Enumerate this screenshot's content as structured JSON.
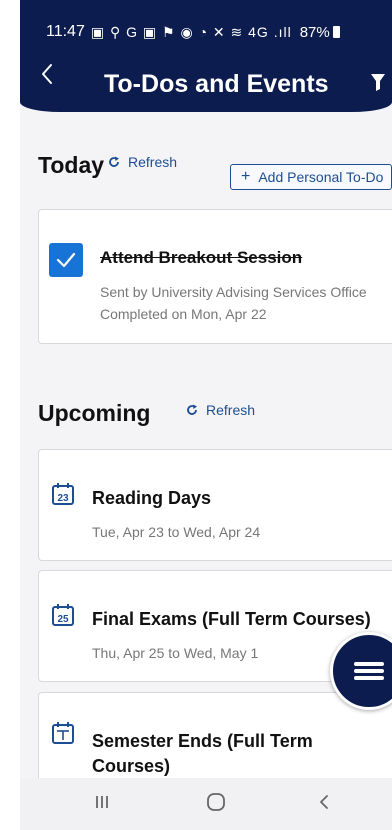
{
  "status_bar": {
    "time": "11:47",
    "icons_text": "▣ ⚲ G ▣ ⚑  ◉ ◔ ✕ ≋ 4G .ıll",
    "battery": "87%"
  },
  "header": {
    "title": "To-Dos and Events",
    "back_icon": "back-arrow-icon",
    "filter_icon": "filter-icon"
  },
  "today": {
    "title": "Today",
    "refresh_label": "Refresh",
    "add_button_label": "Add Personal To-Do",
    "items": [
      {
        "title": "Attend Breakout Session",
        "sender": "Sent by University Advising Services Office",
        "completed": "Completed on Mon, Apr 22",
        "checked": true
      }
    ]
  },
  "upcoming": {
    "title": "Upcoming",
    "refresh_label": "Refresh",
    "events": [
      {
        "title": "Reading Days",
        "dates": "Tue, Apr 23 to Wed, Apr 24",
        "icon_day": "23"
      },
      {
        "title": "Final Exams (Full Term Courses)",
        "dates": "Thu, Apr 25 to Wed, May 1",
        "icon_day": "25"
      },
      {
        "title_line1": "Semester Ends (Full Term",
        "title_line2": "Courses)",
        "icon_day": ""
      }
    ]
  },
  "colors": {
    "header_bg": "#0c1c4f",
    "accent_blue": "#1d4e93",
    "checkbox_blue": "#1773d6",
    "app_bg": "#f4f4f6"
  },
  "nav": {
    "recents_icon": "recents-icon",
    "home_icon": "home-icon",
    "back_icon": "nav-back-icon"
  }
}
